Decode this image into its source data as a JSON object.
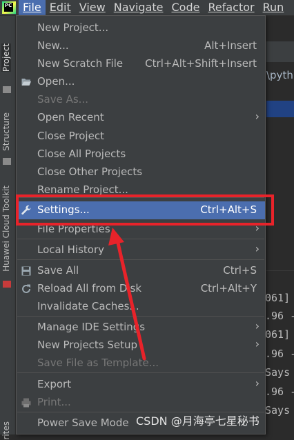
{
  "app_logo": "PC",
  "menubar": [
    {
      "label": "File",
      "active": true
    },
    {
      "label": "Edit"
    },
    {
      "label": "View"
    },
    {
      "label": "Navigate"
    },
    {
      "label": "Code"
    },
    {
      "label": "Refactor"
    },
    {
      "label": "Run"
    }
  ],
  "background": {
    "breadcrumb": "rob",
    "side_tabs": [
      "Project",
      "Structure",
      "Huawei Cloud Toolkit",
      "rites"
    ],
    "editor_path": "\\pyth",
    "console_lines": [
      "061]",
      ".96 -",
      "061]",
      ".96 -",
      "Says",
      ".96 -",
      "Says"
    ]
  },
  "file_menu": {
    "items": [
      {
        "label": "New Project...",
        "shortcut": ""
      },
      {
        "label": "New...",
        "shortcut": "Alt+Insert"
      },
      {
        "label": "New Scratch File",
        "shortcut": "Ctrl+Alt+Shift+Insert"
      },
      {
        "label": "Open...",
        "shortcut": "",
        "icon": "folder-open-icon"
      },
      {
        "label": "Save As...",
        "shortcut": "",
        "disabled": true
      },
      {
        "label": "Open Recent",
        "shortcut": "",
        "submenu": true
      },
      {
        "label": "Close Project",
        "shortcut": ""
      },
      {
        "label": "Close All Projects",
        "shortcut": ""
      },
      {
        "label": "Close Other Projects",
        "shortcut": ""
      },
      {
        "label": "Rename Project...",
        "shortcut": ""
      },
      {
        "label": "Settings...",
        "shortcut": "Ctrl+Alt+S",
        "icon": "wrench-icon",
        "selected": true
      },
      {
        "label": "File Properties",
        "shortcut": "",
        "submenu": true
      },
      {
        "label": "Local History",
        "shortcut": "",
        "submenu": true
      },
      {
        "label": "Save All",
        "shortcut": "Ctrl+S",
        "icon": "save-icon"
      },
      {
        "label": "Reload All from Disk",
        "shortcut": "Ctrl+Alt+Y",
        "icon": "reload-icon"
      },
      {
        "label": "Invalidate Caches...",
        "shortcut": ""
      },
      {
        "label": "Manage IDE Settings",
        "shortcut": "",
        "submenu": true
      },
      {
        "label": "New Projects Setup",
        "shortcut": "",
        "submenu": true
      },
      {
        "label": "Save File as Template...",
        "shortcut": "",
        "disabled": true
      },
      {
        "label": "Export",
        "shortcut": "",
        "submenu": true
      },
      {
        "label": "Print...",
        "shortcut": "",
        "icon": "print-icon",
        "disabled": true
      },
      {
        "label": "Power Save Mode",
        "shortcut": ""
      }
    ]
  },
  "submenu_arrow": "›",
  "watermark": "CSDN @月海亭七星秘书",
  "colors": {
    "menu_bg": "#3c3f41",
    "selection": "#4b6eaf",
    "annotation_red": "#e8232a",
    "disabled_text": "#777777"
  }
}
